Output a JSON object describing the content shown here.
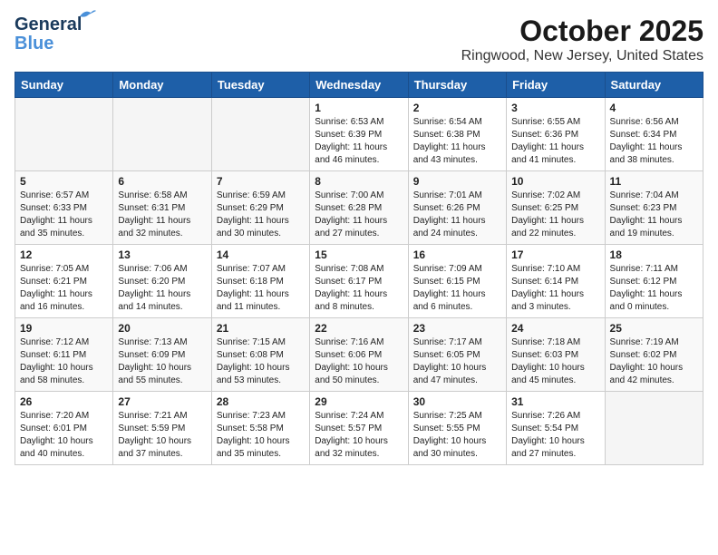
{
  "header": {
    "logo_line1": "General",
    "logo_line2": "Blue",
    "title": "October 2025",
    "subtitle": "Ringwood, New Jersey, United States"
  },
  "weekdays": [
    "Sunday",
    "Monday",
    "Tuesday",
    "Wednesday",
    "Thursday",
    "Friday",
    "Saturday"
  ],
  "weeks": [
    [
      {
        "day": "",
        "info": ""
      },
      {
        "day": "",
        "info": ""
      },
      {
        "day": "",
        "info": ""
      },
      {
        "day": "1",
        "info": "Sunrise: 6:53 AM\nSunset: 6:39 PM\nDaylight: 11 hours\nand 46 minutes."
      },
      {
        "day": "2",
        "info": "Sunrise: 6:54 AM\nSunset: 6:38 PM\nDaylight: 11 hours\nand 43 minutes."
      },
      {
        "day": "3",
        "info": "Sunrise: 6:55 AM\nSunset: 6:36 PM\nDaylight: 11 hours\nand 41 minutes."
      },
      {
        "day": "4",
        "info": "Sunrise: 6:56 AM\nSunset: 6:34 PM\nDaylight: 11 hours\nand 38 minutes."
      }
    ],
    [
      {
        "day": "5",
        "info": "Sunrise: 6:57 AM\nSunset: 6:33 PM\nDaylight: 11 hours\nand 35 minutes."
      },
      {
        "day": "6",
        "info": "Sunrise: 6:58 AM\nSunset: 6:31 PM\nDaylight: 11 hours\nand 32 minutes."
      },
      {
        "day": "7",
        "info": "Sunrise: 6:59 AM\nSunset: 6:29 PM\nDaylight: 11 hours\nand 30 minutes."
      },
      {
        "day": "8",
        "info": "Sunrise: 7:00 AM\nSunset: 6:28 PM\nDaylight: 11 hours\nand 27 minutes."
      },
      {
        "day": "9",
        "info": "Sunrise: 7:01 AM\nSunset: 6:26 PM\nDaylight: 11 hours\nand 24 minutes."
      },
      {
        "day": "10",
        "info": "Sunrise: 7:02 AM\nSunset: 6:25 PM\nDaylight: 11 hours\nand 22 minutes."
      },
      {
        "day": "11",
        "info": "Sunrise: 7:04 AM\nSunset: 6:23 PM\nDaylight: 11 hours\nand 19 minutes."
      }
    ],
    [
      {
        "day": "12",
        "info": "Sunrise: 7:05 AM\nSunset: 6:21 PM\nDaylight: 11 hours\nand 16 minutes."
      },
      {
        "day": "13",
        "info": "Sunrise: 7:06 AM\nSunset: 6:20 PM\nDaylight: 11 hours\nand 14 minutes."
      },
      {
        "day": "14",
        "info": "Sunrise: 7:07 AM\nSunset: 6:18 PM\nDaylight: 11 hours\nand 11 minutes."
      },
      {
        "day": "15",
        "info": "Sunrise: 7:08 AM\nSunset: 6:17 PM\nDaylight: 11 hours\nand 8 minutes."
      },
      {
        "day": "16",
        "info": "Sunrise: 7:09 AM\nSunset: 6:15 PM\nDaylight: 11 hours\nand 6 minutes."
      },
      {
        "day": "17",
        "info": "Sunrise: 7:10 AM\nSunset: 6:14 PM\nDaylight: 11 hours\nand 3 minutes."
      },
      {
        "day": "18",
        "info": "Sunrise: 7:11 AM\nSunset: 6:12 PM\nDaylight: 11 hours\nand 0 minutes."
      }
    ],
    [
      {
        "day": "19",
        "info": "Sunrise: 7:12 AM\nSunset: 6:11 PM\nDaylight: 10 hours\nand 58 minutes."
      },
      {
        "day": "20",
        "info": "Sunrise: 7:13 AM\nSunset: 6:09 PM\nDaylight: 10 hours\nand 55 minutes."
      },
      {
        "day": "21",
        "info": "Sunrise: 7:15 AM\nSunset: 6:08 PM\nDaylight: 10 hours\nand 53 minutes."
      },
      {
        "day": "22",
        "info": "Sunrise: 7:16 AM\nSunset: 6:06 PM\nDaylight: 10 hours\nand 50 minutes."
      },
      {
        "day": "23",
        "info": "Sunrise: 7:17 AM\nSunset: 6:05 PM\nDaylight: 10 hours\nand 47 minutes."
      },
      {
        "day": "24",
        "info": "Sunrise: 7:18 AM\nSunset: 6:03 PM\nDaylight: 10 hours\nand 45 minutes."
      },
      {
        "day": "25",
        "info": "Sunrise: 7:19 AM\nSunset: 6:02 PM\nDaylight: 10 hours\nand 42 minutes."
      }
    ],
    [
      {
        "day": "26",
        "info": "Sunrise: 7:20 AM\nSunset: 6:01 PM\nDaylight: 10 hours\nand 40 minutes."
      },
      {
        "day": "27",
        "info": "Sunrise: 7:21 AM\nSunset: 5:59 PM\nDaylight: 10 hours\nand 37 minutes."
      },
      {
        "day": "28",
        "info": "Sunrise: 7:23 AM\nSunset: 5:58 PM\nDaylight: 10 hours\nand 35 minutes."
      },
      {
        "day": "29",
        "info": "Sunrise: 7:24 AM\nSunset: 5:57 PM\nDaylight: 10 hours\nand 32 minutes."
      },
      {
        "day": "30",
        "info": "Sunrise: 7:25 AM\nSunset: 5:55 PM\nDaylight: 10 hours\nand 30 minutes."
      },
      {
        "day": "31",
        "info": "Sunrise: 7:26 AM\nSunset: 5:54 PM\nDaylight: 10 hours\nand 27 minutes."
      },
      {
        "day": "",
        "info": ""
      }
    ]
  ]
}
